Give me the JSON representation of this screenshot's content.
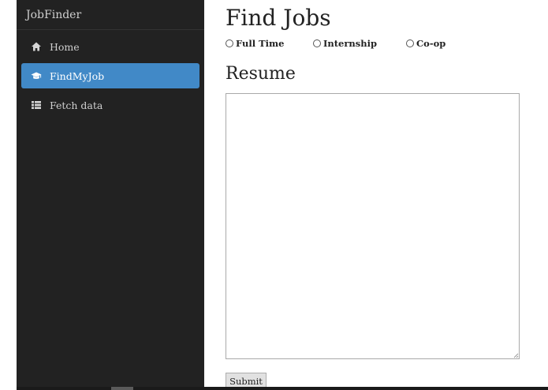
{
  "sidebar": {
    "brand": "JobFinder",
    "items": [
      {
        "label": "Home",
        "icon": "home-icon",
        "active": false
      },
      {
        "label": "FindMyJob",
        "icon": "graduation-cap-icon",
        "active": true
      },
      {
        "label": "Fetch data",
        "icon": "list-icon",
        "active": false
      }
    ]
  },
  "main": {
    "title": "Find Jobs",
    "job_types": [
      "Full Time",
      "Internship",
      "Co-op"
    ],
    "resume_heading": "Resume",
    "resume_value": "",
    "submit_label": "Submit"
  },
  "colors": {
    "sidebar_bg": "#222222",
    "active_item": "#4189c7"
  }
}
